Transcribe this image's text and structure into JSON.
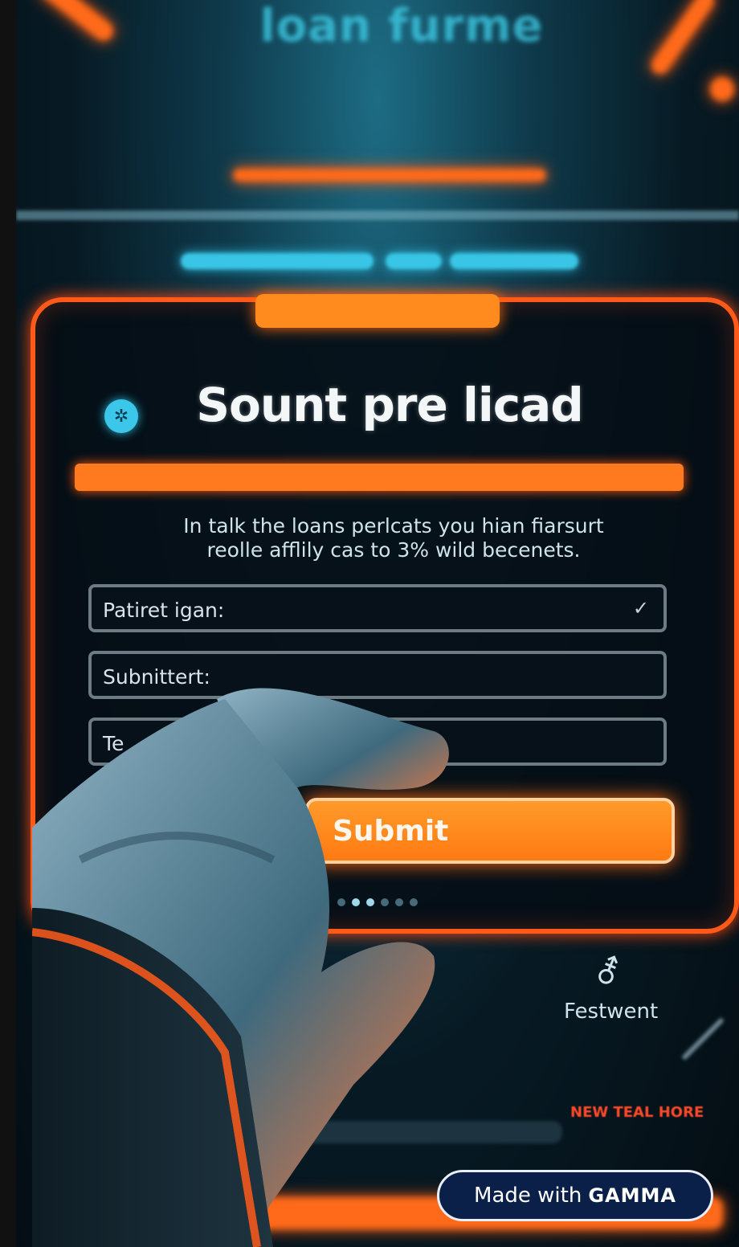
{
  "header": {
    "title": "loan furme"
  },
  "panel": {
    "title": "Sount pre licad",
    "description_line1": "In talk the loans perlcats you hian fiarsurt",
    "description_line2": "reolle afflily cas to 3% wild becenets.",
    "fields": [
      {
        "label": "Patiret igan:",
        "has_check": true
      },
      {
        "label": "Subnittert:"
      },
      {
        "label": "Te"
      }
    ],
    "submit_label": "Submit",
    "progress_fraction": 1.0
  },
  "feature": {
    "label": "Festwent",
    "icon": "gender-icon"
  },
  "tag_text": "NEW TEAL HORE",
  "badge": {
    "prefix": "Made with",
    "brand": "GAMMA"
  },
  "colors": {
    "accent": "#ff6a1a",
    "cyan": "#39c6e6",
    "panel_bg": "#050e16"
  }
}
